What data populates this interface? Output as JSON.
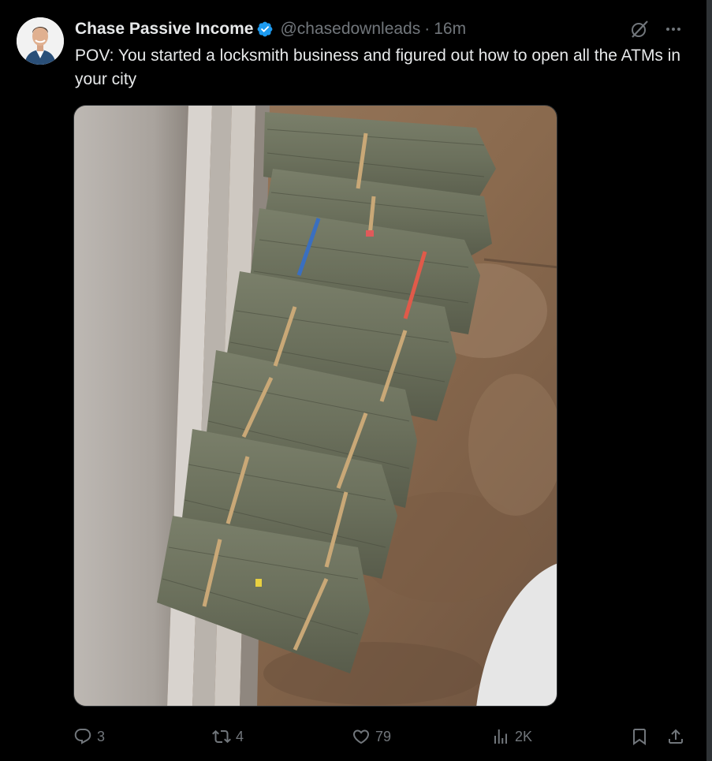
{
  "post": {
    "author": {
      "display_name": "Chase Passive Income",
      "verified": true,
      "handle": "@chasedownleads",
      "time_ago": "16m"
    },
    "text": "POV: You started a locksmith business and figured out how to open all the ATMs in your city",
    "metrics": {
      "replies": "3",
      "reposts": "4",
      "likes": "79",
      "views": "2K"
    }
  },
  "icons": {
    "verified": "verified-badge-icon",
    "grok": "grok-icon",
    "more": "more-dots-icon",
    "reply": "reply-icon",
    "repost": "repost-icon",
    "like": "heart-icon",
    "views": "analytics-icon",
    "bookmark": "bookmark-icon",
    "share": "share-icon"
  },
  "colors": {
    "background": "#000000",
    "text_primary": "#e7e9ea",
    "text_secondary": "#71767b",
    "verified_blue": "#1d9bf0"
  }
}
